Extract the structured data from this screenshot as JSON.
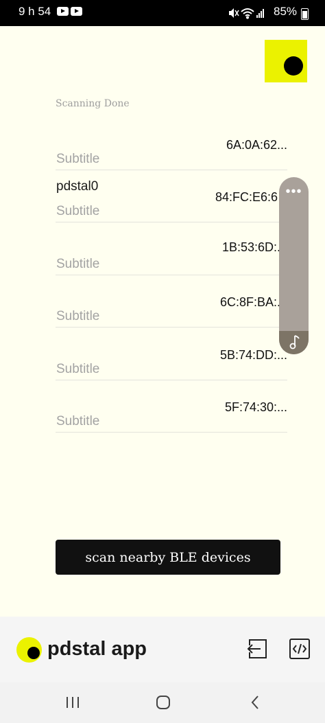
{
  "status_bar": {
    "time": "9 h 54",
    "battery": "85%",
    "icons": [
      "youtube-icon",
      "youtube-icon",
      "mute-icon",
      "wifi-icon",
      "signal-icon",
      "battery-icon"
    ]
  },
  "scan_status": "Scanning Done",
  "devices": [
    {
      "name": "",
      "subtitle": "Subtitle",
      "mac": "6A:0A:62..."
    },
    {
      "name": "pdstal0",
      "subtitle": "Subtitle",
      "mac": "84:FC:E6:6"
    },
    {
      "name": "",
      "subtitle": "Subtitle",
      "mac": "1B:53:6D:..."
    },
    {
      "name": "",
      "subtitle": "Subtitle",
      "mac": "6C:8F:BA:..."
    },
    {
      "name": "",
      "subtitle": "Subtitle",
      "mac": "5B:74:DD:..."
    },
    {
      "name": "",
      "subtitle": "Subtitle",
      "mac": "5F:74:30:..."
    }
  ],
  "floating_panel": {
    "dots": "•••",
    "icon": "music-note-icon"
  },
  "scan_button": {
    "label": "scan nearby BLE devices"
  },
  "app_bar": {
    "title": "pdstal app",
    "icons": [
      "logout-icon",
      "code-icon"
    ]
  },
  "colors": {
    "background": "#fffff0",
    "accent_yellow": "#ebf200",
    "button_dark": "#111111",
    "subtitle_gray": "#a3a3a3"
  },
  "nav_bar": {
    "icons": [
      "recents-icon",
      "home-icon",
      "back-icon"
    ]
  }
}
